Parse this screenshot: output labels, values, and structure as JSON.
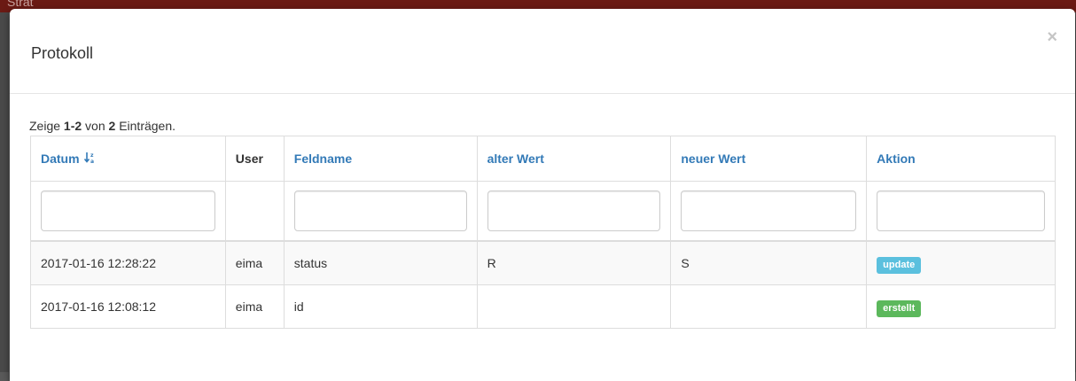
{
  "background": {
    "partial_text": "Strat"
  },
  "modal": {
    "title": "Protokoll",
    "close": "×"
  },
  "summary": {
    "prefix": "Zeige ",
    "range": "1-2",
    "mid": " von ",
    "total": "2",
    "suffix": " Einträgen."
  },
  "table": {
    "columns": [
      {
        "label": "Datum",
        "sortable": true,
        "sorted": "asc",
        "icon": "sort-alpha-asc-icon"
      },
      {
        "label": "User",
        "sortable": false
      },
      {
        "label": "Feldname",
        "sortable": true
      },
      {
        "label": "alter Wert",
        "sortable": true
      },
      {
        "label": "neuer Wert",
        "sortable": true
      },
      {
        "label": "Aktion",
        "sortable": true
      }
    ],
    "filters": [
      "",
      "",
      "",
      "",
      ""
    ],
    "rows": [
      {
        "datum": "2017-01-16 12:28:22",
        "user": "eima",
        "feldname": "status",
        "alter_wert": "R",
        "neuer_wert": "S",
        "aktion": "update"
      },
      {
        "datum": "2017-01-16 12:08:12",
        "user": "eima",
        "feldname": "id",
        "alter_wert": "",
        "neuer_wert": "",
        "aktion": "erstellt"
      }
    ]
  },
  "colors": {
    "link": "#337ab7",
    "badge_update": "#5bc0de",
    "badge_erstellt": "#5cb85c",
    "header_bar": "#6b1a14"
  }
}
